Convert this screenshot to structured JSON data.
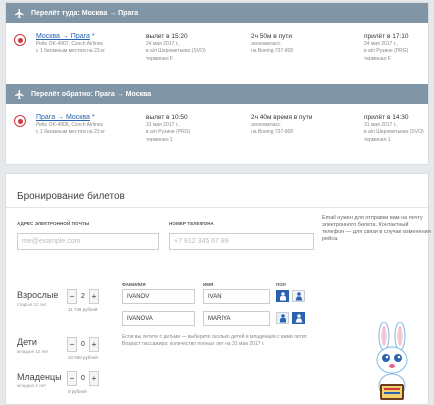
{
  "outbound": {
    "header": "Перелёт туда: Москва → Прага",
    "route": "Москва → Прага",
    "star": "*",
    "flight": "Рейс OK-4907, Czech Airlines",
    "baggage": "с 1 багажным местом на 23 кг",
    "depart": "вылет в 15:20",
    "depart_date": "24 мая 2017 г.,",
    "depart_airport": "в а/п Шереметьево (SVO)",
    "depart_terminal": "терминал F",
    "duration": "2ч 50м в пути",
    "class": "экономкласс",
    "aircraft": "на Boeing 737-800",
    "arrive": "прилёт в 17:10",
    "arrive_date": "24 мая 2017 г.,",
    "arrive_airport": "в а/п Рузине (PRG)",
    "arrive_terminal": "терминал F"
  },
  "inbound": {
    "header": "Перелёт обратно: Прага → Москва",
    "route": "Прага → Москва",
    "star": "*",
    "flight": "Рейс OK-4906, Czech Airlines",
    "baggage": "с 1 багажным местом на 23 кг",
    "depart": "вылет в 10:50",
    "depart_date": "31 мая 2017 г.,",
    "depart_airport": "в а/п Рузине (PRG)",
    "depart_terminal": "терминал 1",
    "duration": "2ч 40м время в пути",
    "class": "экономкласс",
    "aircraft": "на Boeing 737-800",
    "arrive": "прилёт в 14:30",
    "arrive_date": "31 мая 2017 г.,",
    "arrive_airport": "в а/п Шереметьево (SVO)",
    "arrive_terminal": "терминал 1"
  },
  "booking": {
    "title": "Бронирование билетов",
    "email_label": "АДРЕС ЭЛЕКТРОННОЙ ПОЧТЫ",
    "email_placeholder": "me@example.com",
    "phone_label": "НОМЕР ТЕЛЕФОНА",
    "phone_placeholder": "+7 912 345 67 89",
    "note": "Email нужен для отправки вам на почту электронного билета. Контактный телефон — для связи в случае изменения рейса.",
    "col_surname": "ФАМИЛИЯ",
    "col_name": "ИМЯ",
    "col_gender": "ПОЛ",
    "adults": {
      "label": "Взрослые",
      "sub": "старше 12 лет",
      "count": "2",
      "price": "11 746 рублей"
    },
    "children": {
      "label": "Дети",
      "sub": "младше 12 лет",
      "count": "0",
      "price": "10 550 рублей"
    },
    "infants": {
      "label": "Младенцы",
      "sub": "младше 2 лет",
      "count": "0",
      "price": "0 рублей"
    },
    "minus": "−",
    "plus": "+",
    "passengers": [
      {
        "surname": "IVANOV",
        "name": "IVAN"
      },
      {
        "surname": "IVANOVA",
        "name": "MARIYA"
      }
    ],
    "kids_note": "Если вы летите с детьми — выберите сколько детей и младенцев с вами летит. Возраст пассажира: количество полных лет на 31 мая 2017 г."
  },
  "colors": {
    "bar": "#8095a6",
    "link": "#2a62b0",
    "brand": "#d0363b"
  },
  "icons": [
    "plane-icon",
    "czech-airlines-logo-icon",
    "male-icon",
    "female-icon"
  ]
}
